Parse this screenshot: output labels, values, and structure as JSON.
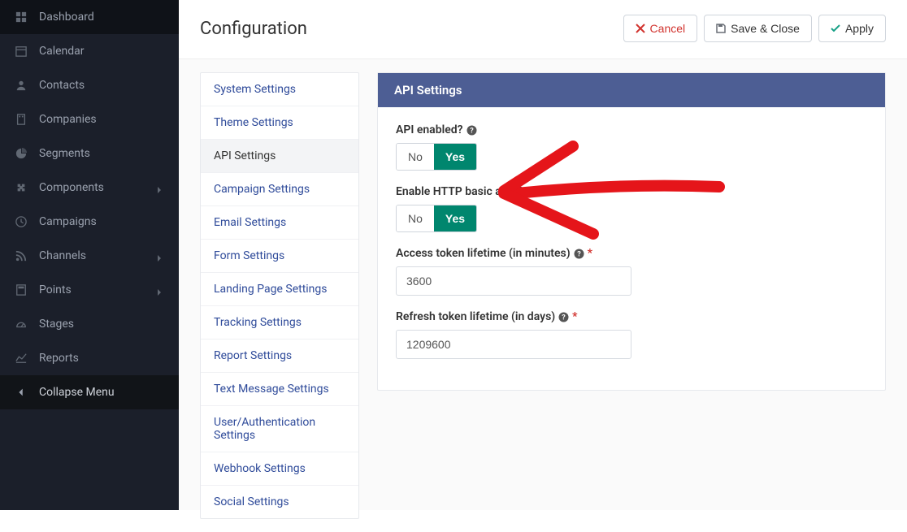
{
  "sidebar": {
    "items": [
      {
        "label": "Dashboard",
        "icon": "grid"
      },
      {
        "label": "Calendar",
        "icon": "calendar"
      },
      {
        "label": "Contacts",
        "icon": "user"
      },
      {
        "label": "Companies",
        "icon": "building"
      },
      {
        "label": "Segments",
        "icon": "pie"
      },
      {
        "label": "Components",
        "icon": "puzzle",
        "chevron": true
      },
      {
        "label": "Campaigns",
        "icon": "clock"
      },
      {
        "label": "Channels",
        "icon": "rss",
        "chevron": true
      },
      {
        "label": "Points",
        "icon": "calc",
        "chevron": true
      },
      {
        "label": "Stages",
        "icon": "gauge"
      },
      {
        "label": "Reports",
        "icon": "chart"
      }
    ],
    "collapse_label": "Collapse Menu"
  },
  "header": {
    "title": "Configuration",
    "cancel_label": "Cancel",
    "save_label": "Save & Close",
    "apply_label": "Apply"
  },
  "settings_nav": {
    "items": [
      "System Settings",
      "Theme Settings",
      "API Settings",
      "Campaign Settings",
      "Email Settings",
      "Form Settings",
      "Landing Page Settings",
      "Tracking Settings",
      "Report Settings",
      "Text Message Settings",
      "User/Authentication Settings",
      "Webhook Settings",
      "Social Settings"
    ],
    "active_index": 2
  },
  "panel": {
    "title": "API Settings",
    "fields": {
      "api_enabled": {
        "label": "API enabled?",
        "no": "No",
        "yes": "Yes",
        "value": "Yes"
      },
      "basic_auth": {
        "label": "Enable HTTP basic auth?",
        "no": "No",
        "yes": "Yes",
        "value": "Yes"
      },
      "access_token": {
        "label": "Access token lifetime (in minutes)",
        "value": "3600"
      },
      "refresh_token": {
        "label": "Refresh token lifetime (in days)",
        "value": "1209600"
      }
    }
  }
}
